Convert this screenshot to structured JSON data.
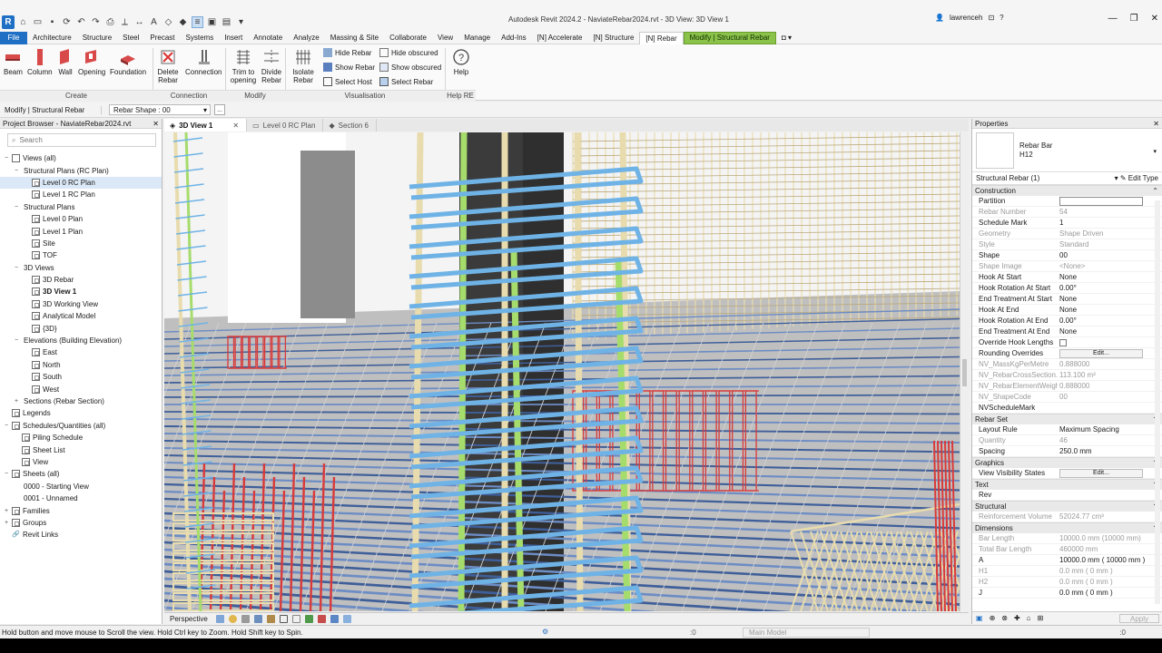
{
  "titlebar": {
    "title": "Autodesk Revit 2024.2 - NaviateRebar2024.rvt - 3D View: 3D View 1",
    "user": "lawrenceh",
    "help": "?"
  },
  "ribbon_tabs": [
    "File",
    "Architecture",
    "Structure",
    "Steel",
    "Precast",
    "Systems",
    "Insert",
    "Annotate",
    "Analyze",
    "Massing & Site",
    "Collaborate",
    "View",
    "Manage",
    "Add-Ins",
    "[N] Accelerate",
    "[N] Structure",
    "[N] Rebar",
    "Modify | Structural Rebar"
  ],
  "ribbon": {
    "create": {
      "label": "Create",
      "beam": "Beam",
      "column": "Column",
      "wall": "Wall",
      "opening": "Opening",
      "foundation": "Foundation"
    },
    "connection": {
      "label": "Connection",
      "delete_rebar": "Delete Rebar",
      "connection": "Connection"
    },
    "modify": {
      "label": "Modify",
      "trim": "Trim to opening",
      "divide": "Divide Rebar"
    },
    "visualisation": {
      "label": "Visualisation",
      "isolate": "Isolate Rebar",
      "hide_rebar": "Hide Rebar",
      "show_rebar": "Show Rebar",
      "select_host": "Select Host",
      "hide_obscured": "Hide obscured",
      "show_obscured": "Show obscured",
      "select_rebar": "Select Rebar"
    },
    "help": {
      "label": "Help RE",
      "help": "Help"
    }
  },
  "optionsbar": {
    "context": "Modify | Structural Rebar",
    "rebar_shape": "Rebar Shape : 00",
    "more": "..."
  },
  "project_browser": {
    "title": "Project Browser - NaviateRebar2024.rvt",
    "search_placeholder": "Search",
    "tree": [
      {
        "label": "Views (all)",
        "level": 0,
        "toggle": "−",
        "icon": "views"
      },
      {
        "label": "Structural Plans (RC Plan)",
        "level": 1,
        "toggle": "−"
      },
      {
        "label": "Level 0 RC Plan",
        "level": 2,
        "icon": "view",
        "selected": true
      },
      {
        "label": "Level 1 RC Plan",
        "level": 2,
        "icon": "view"
      },
      {
        "label": "Structural Plans",
        "level": 1,
        "toggle": "−"
      },
      {
        "label": "Level 0 Plan",
        "level": 2,
        "icon": "view"
      },
      {
        "label": "Level 1 Plan",
        "level": 2,
        "icon": "view"
      },
      {
        "label": "Site",
        "level": 2,
        "icon": "view"
      },
      {
        "label": "TOF",
        "level": 2,
        "icon": "view"
      },
      {
        "label": "3D Views",
        "level": 1,
        "toggle": "−"
      },
      {
        "label": "3D Rebar",
        "level": 2,
        "icon": "view"
      },
      {
        "label": "3D View 1",
        "level": 2,
        "icon": "view",
        "bold": true
      },
      {
        "label": "3D Working View",
        "level": 2,
        "icon": "view"
      },
      {
        "label": "Analytical Model",
        "level": 2,
        "icon": "view"
      },
      {
        "label": "{3D}",
        "level": 2,
        "icon": "view"
      },
      {
        "label": "Elevations (Building Elevation)",
        "level": 1,
        "toggle": "−"
      },
      {
        "label": "East",
        "level": 2,
        "icon": "view"
      },
      {
        "label": "North",
        "level": 2,
        "icon": "view"
      },
      {
        "label": "South",
        "level": 2,
        "icon": "view"
      },
      {
        "label": "West",
        "level": 2,
        "icon": "view"
      },
      {
        "label": "Sections (Rebar Section)",
        "level": 1,
        "toggle": "+"
      },
      {
        "label": "Legends",
        "level": 0,
        "icon": "view"
      },
      {
        "label": "Schedules/Quantities (all)",
        "level": 0,
        "toggle": "−",
        "icon": "view"
      },
      {
        "label": "Piling Schedule",
        "level": 1,
        "icon": "view"
      },
      {
        "label": "Sheet List",
        "level": 1,
        "icon": "view"
      },
      {
        "label": "View",
        "level": 1,
        "icon": "view"
      },
      {
        "label": "Sheets (all)",
        "level": 0,
        "toggle": "−",
        "icon": "view"
      },
      {
        "label": "0000 - Starting View",
        "level": 1
      },
      {
        "label": "0001 - Unnamed",
        "level": 1
      },
      {
        "label": "Families",
        "level": 0,
        "toggle": "+",
        "icon": "view"
      },
      {
        "label": "Groups",
        "level": 0,
        "toggle": "+",
        "icon": "view"
      },
      {
        "label": "Revit Links",
        "level": 0,
        "icon": "link"
      }
    ]
  },
  "view_tabs": [
    "3D View 1",
    "Level 0 RC Plan",
    "Section 6"
  ],
  "view_control": {
    "mode": "Perspective"
  },
  "properties": {
    "title": "Properties",
    "type_family": "Rebar Bar",
    "type_name": "H12",
    "instance_selector": "Structural Rebar (1)",
    "edit_type": "Edit Type",
    "groups": [
      {
        "name": "Construction",
        "rows": [
          {
            "name": "Partition",
            "value": "",
            "kind": "field"
          },
          {
            "name": "Rebar Number",
            "value": "54",
            "dim": true
          },
          {
            "name": "Schedule Mark",
            "value": "1"
          },
          {
            "name": "Geometry",
            "value": "Shape Driven",
            "dim": true
          },
          {
            "name": "Style",
            "value": "Standard",
            "dim": true
          },
          {
            "name": "Shape",
            "value": "00"
          },
          {
            "name": "Shape Image",
            "value": "<None>",
            "dim": true
          },
          {
            "name": "Hook At Start",
            "value": "None"
          },
          {
            "name": "Hook Rotation At Start",
            "value": "0.00°"
          },
          {
            "name": "End Treatment At Start",
            "value": "None"
          },
          {
            "name": "Hook At End",
            "value": "None"
          },
          {
            "name": "Hook Rotation At End",
            "value": "0.00°"
          },
          {
            "name": "End Treatment At End",
            "value": "None"
          },
          {
            "name": "Override Hook Lengths",
            "value": "",
            "kind": "check"
          },
          {
            "name": "Rounding Overrides",
            "value": "Edit...",
            "kind": "button"
          },
          {
            "name": "NV_MassKgPerMetre",
            "value": "0.888000",
            "dim": true
          },
          {
            "name": "NV_RebarCrossSection...",
            "value": "113.100 m²",
            "dim": true
          },
          {
            "name": "NV_RebarElementWeight",
            "value": "0.888000",
            "dim": true
          },
          {
            "name": "NV_ShapeCode",
            "value": "00",
            "dim": true
          },
          {
            "name": "NVScheduleMark",
            "value": ""
          }
        ]
      },
      {
        "name": "Rebar Set",
        "rows": [
          {
            "name": "Layout Rule",
            "value": "Maximum Spacing"
          },
          {
            "name": "Quantity",
            "value": "46",
            "dim": true
          },
          {
            "name": "Spacing",
            "value": "250.0 mm"
          }
        ]
      },
      {
        "name": "Graphics",
        "rows": [
          {
            "name": "View Visibility States",
            "value": "Edit...",
            "kind": "button"
          }
        ]
      },
      {
        "name": "Text",
        "rows": [
          {
            "name": "Rev",
            "value": ""
          }
        ]
      },
      {
        "name": "Structural",
        "rows": [
          {
            "name": "Reinforcement Volume",
            "value": "52024.77 cm³",
            "dim": true
          }
        ]
      },
      {
        "name": "Dimensions",
        "rows": [
          {
            "name": "Bar Length",
            "value": "10000.0 mm (10000 mm)",
            "dim": true
          },
          {
            "name": "Total Bar Length",
            "value": "460000 mm",
            "dim": true
          },
          {
            "name": "A",
            "value": "10000.0 mm ( 10000 mm )"
          },
          {
            "name": "H1",
            "value": "0.0 mm ( 0 mm )",
            "dim": true
          },
          {
            "name": "H2",
            "value": "0.0 mm ( 0 mm )",
            "dim": true
          },
          {
            "name": "J",
            "value": "0.0 mm ( 0 mm )"
          }
        ]
      }
    ],
    "apply": "Apply"
  },
  "statusbar": {
    "text": "Hold button and move mouse to Scroll the view. Hold Ctrl key to Zoom. Hold Shift key to Spin.",
    "zero": ":0",
    "model": "Main Model",
    "filter": ":0"
  },
  "colors": {
    "file_tab": "#1f6fc5",
    "contextual_tab": "#8bc34a",
    "rebar_blue": "#6fb3e6",
    "rebar_green": "#a6dc6c",
    "rebar_red": "#d93a3a",
    "rebar_tan": "#e8dcae"
  }
}
